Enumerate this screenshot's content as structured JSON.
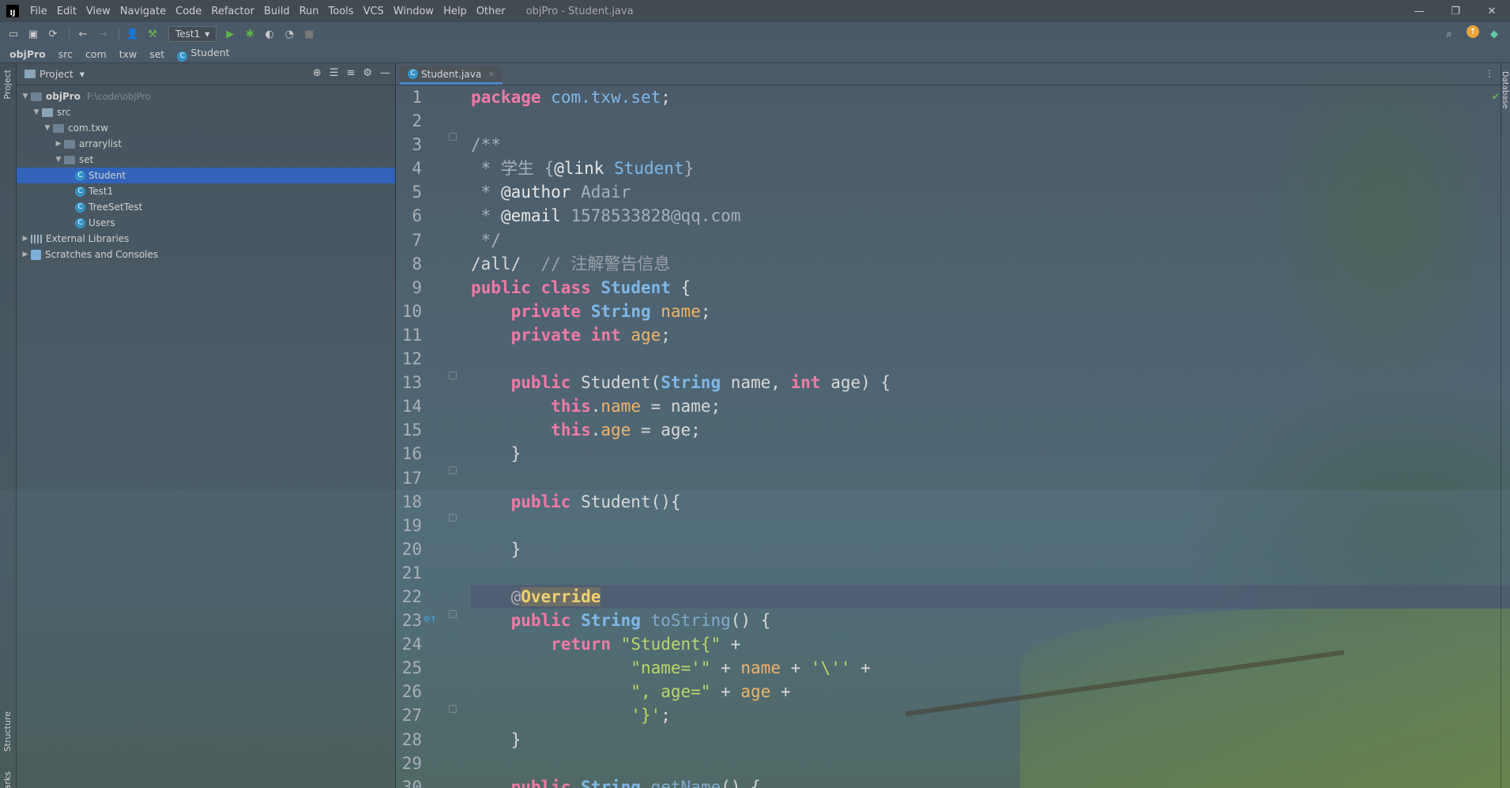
{
  "window": {
    "title": "objPro - Student.java",
    "logo_text": "IJ",
    "controls": [
      "—",
      "❐",
      "✕"
    ]
  },
  "menu": [
    "File",
    "Edit",
    "View",
    "Navigate",
    "Code",
    "Refactor",
    "Build",
    "Run",
    "Tools",
    "VCS",
    "Window",
    "Help",
    "Other"
  ],
  "toolbar": {
    "run_config": "Test1"
  },
  "breadcrumb": [
    "objPro",
    "src",
    "com",
    "txw",
    "set",
    "Student"
  ],
  "left_strip": {
    "project": "Project",
    "structure": "Structure",
    "bookmarks": "Bookmarks"
  },
  "right_strip": {
    "database": "Database"
  },
  "project_panel": {
    "title": "Project",
    "tree": [
      {
        "label": "objPro",
        "hint": "F:\\code\\objPro",
        "depth": 0,
        "kind": "project",
        "expanded": true
      },
      {
        "label": "src",
        "depth": 1,
        "kind": "folder",
        "expanded": true
      },
      {
        "label": "com.txw",
        "depth": 2,
        "kind": "package",
        "expanded": true
      },
      {
        "label": "arrarylist",
        "depth": 3,
        "kind": "package",
        "expanded": false
      },
      {
        "label": "set",
        "depth": 3,
        "kind": "package",
        "expanded": true
      },
      {
        "label": "Student",
        "depth": 4,
        "kind": "class",
        "selected": true
      },
      {
        "label": "Test1",
        "depth": 4,
        "kind": "class"
      },
      {
        "label": "TreeSetTest",
        "depth": 4,
        "kind": "class"
      },
      {
        "label": "Users",
        "depth": 4,
        "kind": "class"
      },
      {
        "label": "External Libraries",
        "depth": 0,
        "kind": "library",
        "expanded": false
      },
      {
        "label": "Scratches and Consoles",
        "depth": 0,
        "kind": "scratch",
        "expanded": false
      }
    ]
  },
  "editor": {
    "tab": "Student.java",
    "line_numbers": [
      "1",
      "2",
      "3",
      "4",
      "5",
      "6",
      "7",
      "8",
      "9",
      "10",
      "11",
      "12",
      "13",
      "14",
      "15",
      "16",
      "17",
      "18",
      "19",
      "20",
      "21",
      "22",
      "23",
      "24",
      "25",
      "26",
      "27",
      "28",
      "29",
      "30"
    ],
    "code": {
      "l1": {
        "kw": "package",
        "pkg": "com.txw.set",
        "end": ";"
      },
      "l3": "/**",
      "l4": {
        "a": " * 学生 {",
        "b": "@link",
        "c": "Student",
        "d": "}"
      },
      "l5": {
        "a": " * ",
        "b": "@author",
        "c": " Adair"
      },
      "l6": {
        "a": " * ",
        "b": "@email",
        "c": " 1578533828@qq.com"
      },
      "l7": " */",
      "l8": {
        "a": "/all/",
        "b": "  // 注解警告信息"
      },
      "l9": {
        "a": "public",
        "b": "class",
        "c": "Student",
        "d": " {"
      },
      "l10": {
        "a": "private",
        "b": "String",
        "c": "name",
        "d": ";"
      },
      "l11": {
        "a": "private",
        "b": "int",
        "c": "age",
        "d": ";"
      },
      "l13": {
        "a": "public",
        "b": " Student(",
        "c": "String",
        "d": " name, ",
        "e": "int",
        "f": " age) {"
      },
      "l14": {
        "a": "this",
        "b": ".",
        "c": "name",
        "d": " = name;"
      },
      "l15": {
        "a": "this",
        "b": ".",
        "c": "age",
        "d": " = age;"
      },
      "l16": "}",
      "l18": {
        "a": "public",
        "b": " Student(){"
      },
      "l20": "}",
      "l22": {
        "a": "@",
        "b": "Override"
      },
      "l23": {
        "a": "public",
        "b": "String",
        "c": "toString",
        "d": "() {"
      },
      "l24": {
        "a": "return",
        "b": "\"Student{\"",
        "c": " +"
      },
      "l25": {
        "a": "\"name='\"",
        "b": " + ",
        "c": "name",
        "d": " + ",
        "e": "'\\''",
        "f": " +"
      },
      "l26": {
        "a": "\", age=\"",
        "b": " + ",
        "c": "age",
        "d": " +"
      },
      "l27": {
        "a": "'}'",
        "b": ";"
      },
      "l28": "}",
      "l30": {
        "a": "public",
        "b": "String",
        "c": "getName",
        "d": "() {"
      }
    }
  },
  "colors": {
    "keyword": "#f07aa5",
    "type": "#7fb8e8",
    "field": "#f0b46a",
    "string": "#bcd66b",
    "selection": "#2f65ca"
  }
}
